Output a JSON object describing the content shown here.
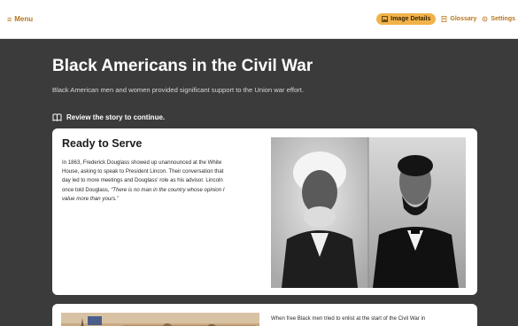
{
  "header": {
    "menu_label": "Menu",
    "image_details_label": "Image Details",
    "glossary_label": "Glossary",
    "settings_label": "Settings"
  },
  "page": {
    "title": "Black Americans in the Civil War",
    "subtitle": "Black American men and women provided significant support to the Union war effort.",
    "review_label": "Review the story to continue."
  },
  "card1": {
    "title": "Ready to Serve",
    "body_lines": [
      "In 1863, Frederick Douglass showed up unannounced at the White",
      "House, asking to speak to President Lincon. Their conversation that",
      "day led to more meetings and Douglass' role as his advisor. Lincoln",
      "once told Douglass, "
    ],
    "quote_part1": "“There is no man in the country whose opinion I",
    "quote_part2": "value more than yours.”"
  },
  "card2": {
    "text": "When free Black men tried to enlist at the start of the Civil War in"
  },
  "colors": {
    "accent": "#b8741a",
    "pill": "#f1b24a",
    "background": "#3b3b3b"
  }
}
